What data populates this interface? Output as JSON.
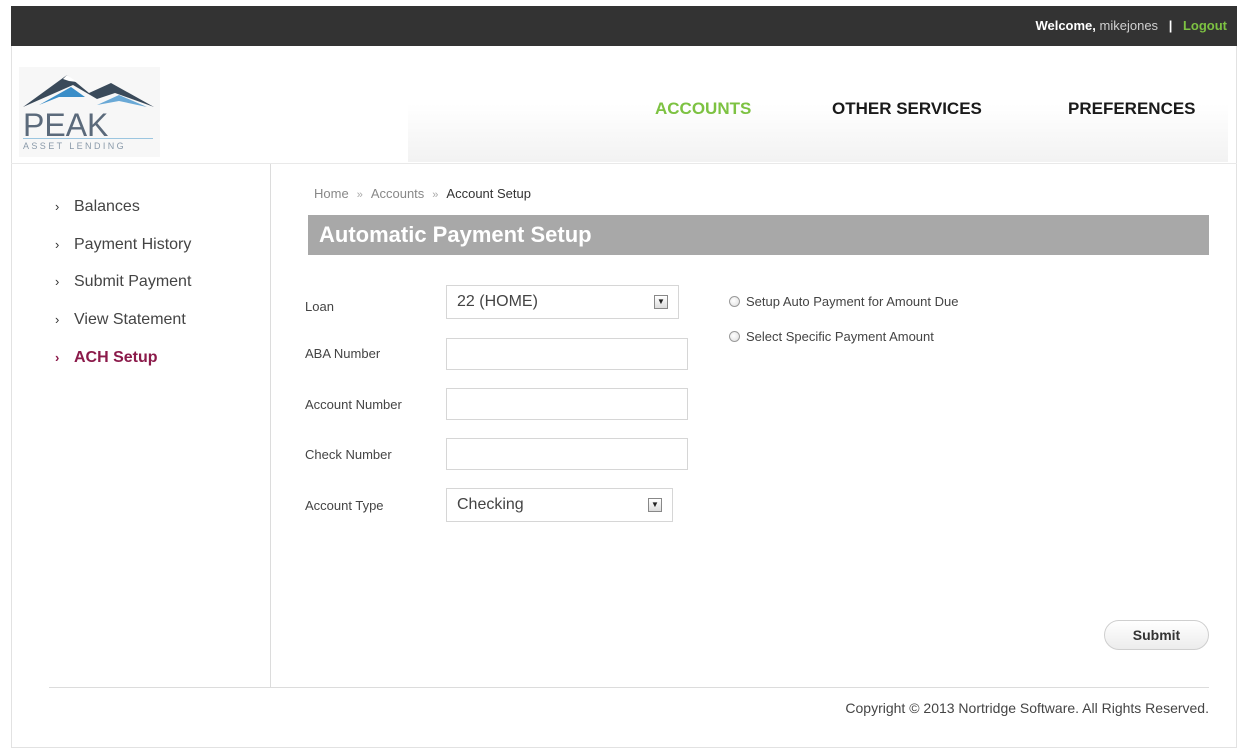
{
  "topbar": {
    "welcome_label": "Welcome,",
    "username": "mikejones",
    "separator": "|",
    "logout_label": "Logout"
  },
  "logo": {
    "word": "PEAK",
    "subtitle": "ASSET LENDING"
  },
  "nav": {
    "items": [
      {
        "label": "ACCOUNTS",
        "active": true
      },
      {
        "label": "OTHER SERVICES",
        "active": false
      },
      {
        "label": "PREFERENCES",
        "active": false
      }
    ]
  },
  "sidebar": {
    "items": [
      {
        "label": "Balances",
        "active": false
      },
      {
        "label": "Payment History",
        "active": false
      },
      {
        "label": "Submit Payment",
        "active": false
      },
      {
        "label": "View Statement",
        "active": false
      },
      {
        "label": "ACH Setup",
        "active": true
      }
    ]
  },
  "breadcrumb": {
    "items": [
      "Home",
      "Accounts",
      "Account Setup"
    ],
    "separator": "»"
  },
  "page_title": "Automatic Payment Setup",
  "form": {
    "loan": {
      "label": "Loan",
      "value": "22 (HOME)"
    },
    "aba": {
      "label": "ABA Number",
      "value": ""
    },
    "account_number": {
      "label": "Account Number",
      "value": ""
    },
    "check_number": {
      "label": "Check Number",
      "value": ""
    },
    "account_type": {
      "label": "Account Type",
      "value": "Checking"
    },
    "radio_options": [
      {
        "label": "Setup Auto Payment for Amount Due",
        "checked": false
      },
      {
        "label": "Select Specific Payment Amount",
        "checked": false
      }
    ],
    "submit_label": "Submit"
  },
  "footer": {
    "copyright": "Copyright © 2013 Nortridge Software. All Rights Reserved."
  },
  "colors": {
    "topbar_bg": "#333333",
    "accent_green": "#7dc242",
    "sidebar_active": "#8b1a4a",
    "title_bar_bg": "#a8a8a8"
  }
}
